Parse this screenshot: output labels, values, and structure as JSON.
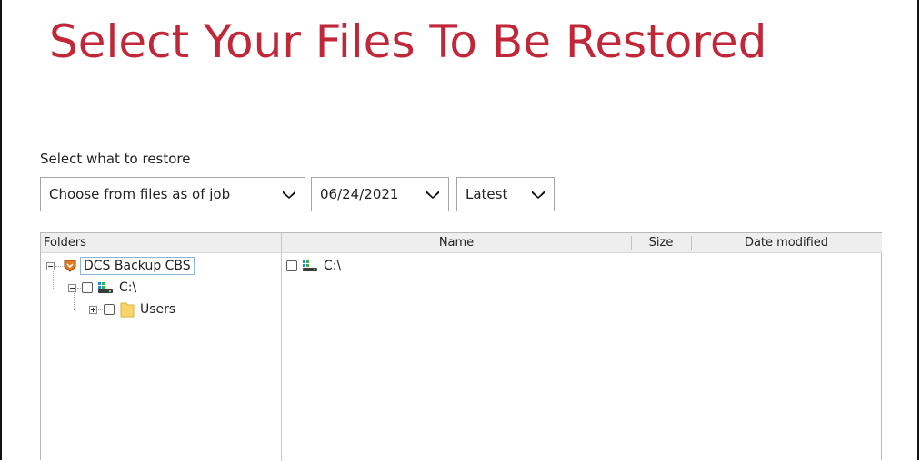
{
  "page_title": "Select Your Files To Be Restored",
  "select_label": "Select what to restore",
  "dropdowns": {
    "source": "Choose from files as of job",
    "date": "06/24/2021",
    "version": "Latest"
  },
  "columns": {
    "folders": "Folders",
    "name": "Name",
    "size": "Size",
    "date_modified": "Date modified"
  },
  "tree": {
    "root": "DCS Backup CBS",
    "drive": "C:\\",
    "folder": "Users"
  },
  "file_list": [
    {
      "name": "C:\\",
      "size": "",
      "date_modified": ""
    }
  ],
  "colors": {
    "title": "#c0283a",
    "backup_set_icon": "#e07a1f",
    "folder_icon": "#f7d56b"
  },
  "icons": {
    "root": "backup-set-icon",
    "drive": "drive-icon",
    "folder": "folder-icon"
  }
}
